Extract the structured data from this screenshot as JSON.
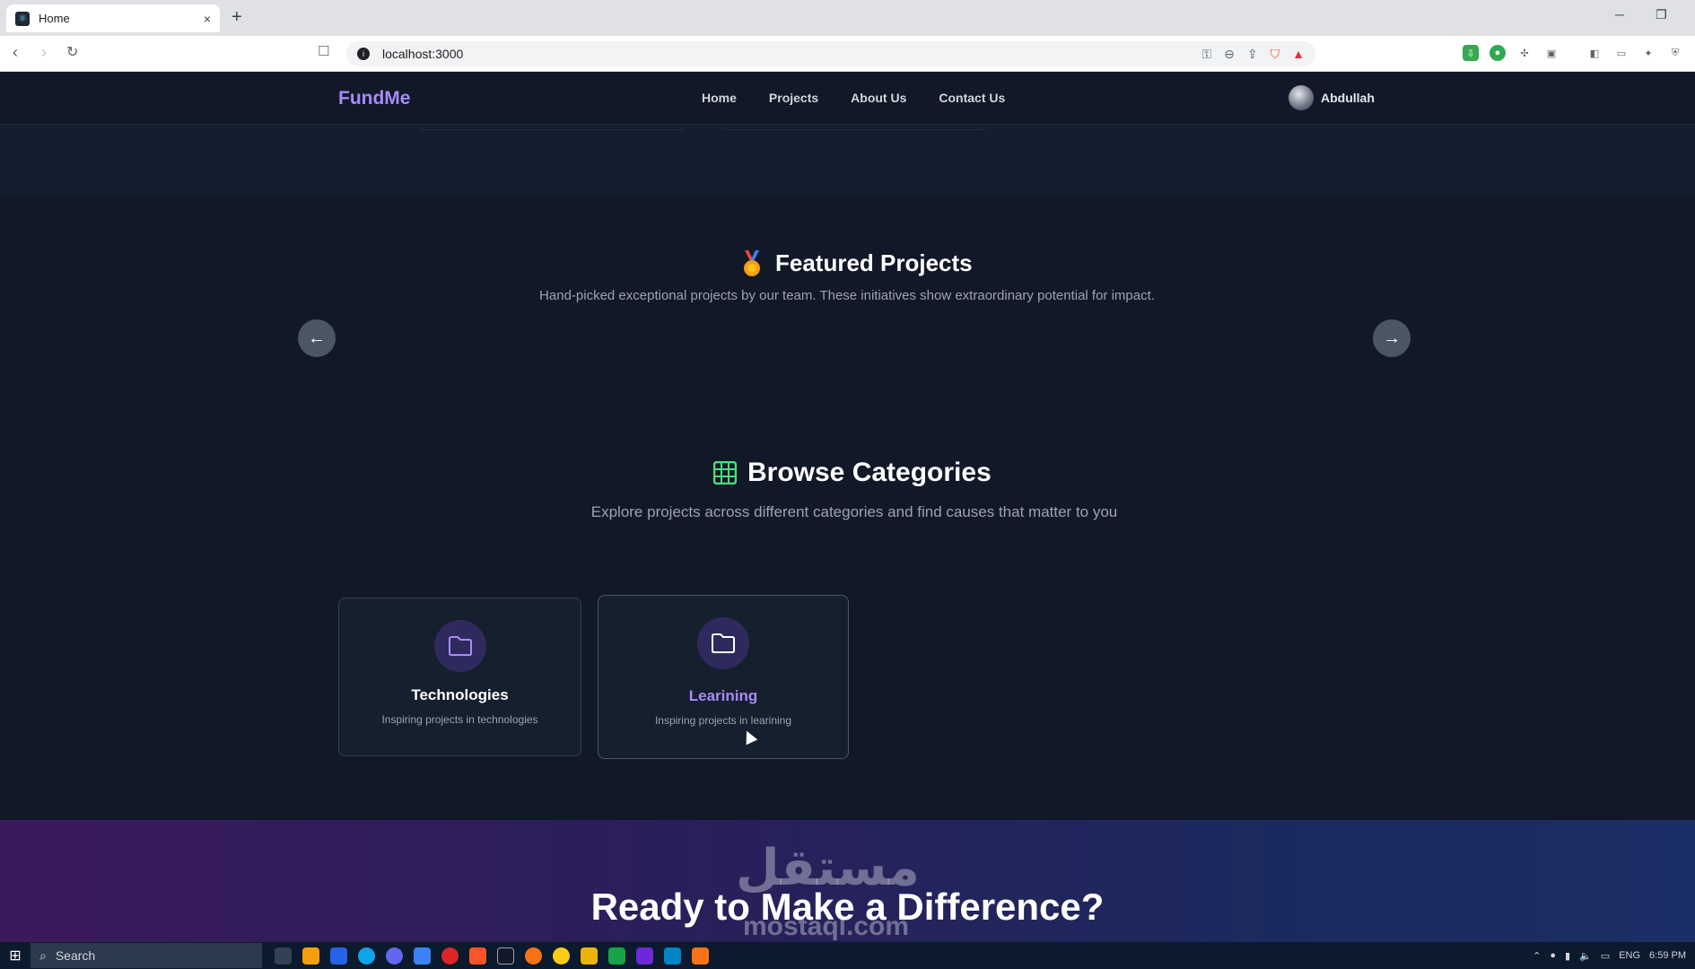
{
  "browser": {
    "tab_title": "Home",
    "new_tab_label": "+",
    "close_tab_label": "×",
    "url": "localhost:3000"
  },
  "site": {
    "brand": "FundMe",
    "nav": [
      "Home",
      "Projects",
      "About Us",
      "Contact Us"
    ],
    "user_name": "Abdullah"
  },
  "featured": {
    "title": "Featured Projects",
    "subtitle": "Hand-picked exceptional projects by our team. These initiatives show extraordinary potential for impact."
  },
  "categories": {
    "title": "Browse Categories",
    "subtitle": "Explore projects across different categories and find causes that matter to you",
    "items": [
      {
        "name": "Technologies",
        "desc": "Inspiring projects in technologies"
      },
      {
        "name": "Learining",
        "desc": "Inspiring projects in learining"
      }
    ]
  },
  "cta": {
    "title": "Ready to Make a Difference?"
  },
  "watermark": {
    "arabic": "مستقل",
    "latin": "mostaql.com"
  },
  "taskbar": {
    "search_label": "Search",
    "language": "ENG",
    "time": "6:59 PM"
  },
  "colors": {
    "brand": "#a78bfa",
    "page_bg": "#111827",
    "card_icon_bg": "#2e2a5e",
    "active_card_title": "#a78bfa"
  }
}
